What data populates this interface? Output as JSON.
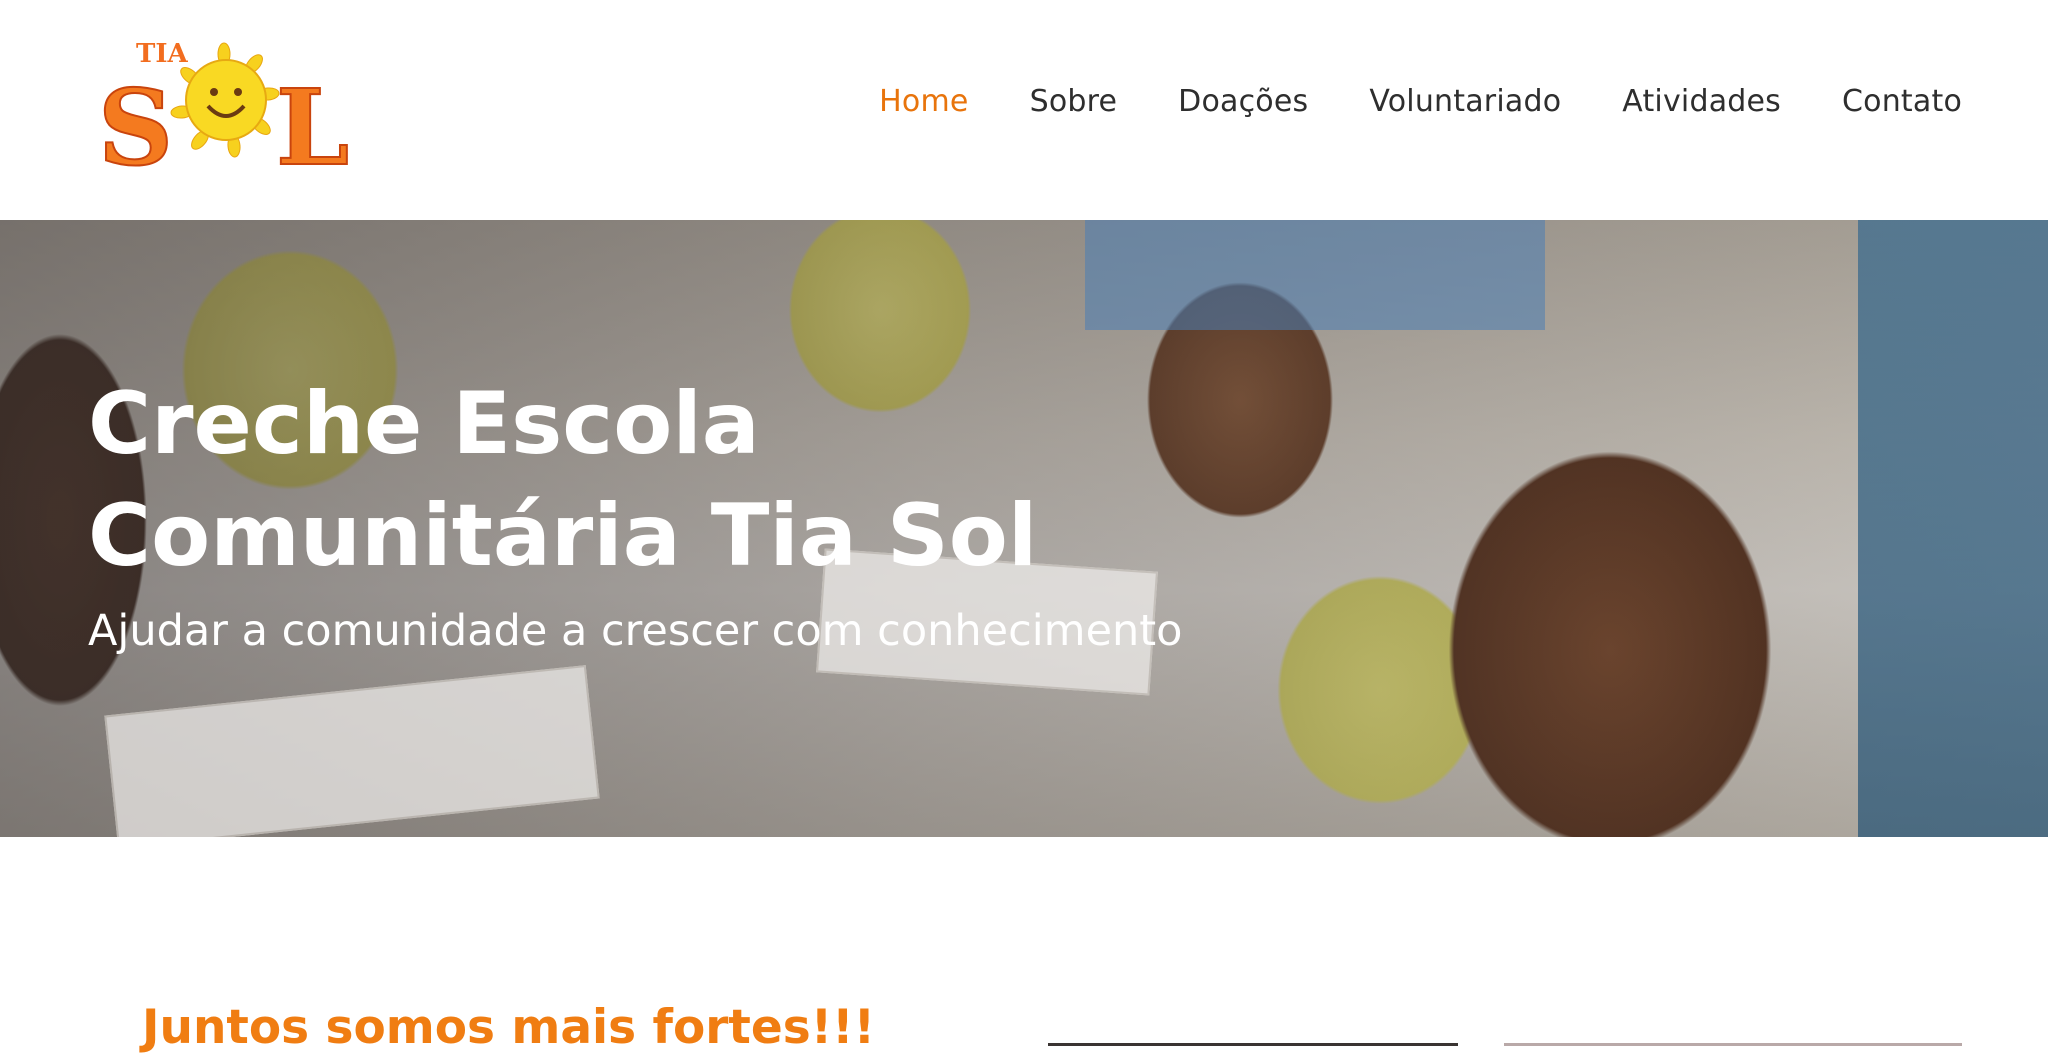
{
  "brand": {
    "logo_top": "TIA",
    "logo_main": "SOL"
  },
  "nav": {
    "items": [
      {
        "label": "Home",
        "active": true
      },
      {
        "label": "Sobre",
        "active": false
      },
      {
        "label": "Doações",
        "active": false
      },
      {
        "label": "Voluntariado",
        "active": false
      },
      {
        "label": "Atividades",
        "active": false
      },
      {
        "label": "Contato",
        "active": false
      }
    ]
  },
  "hero": {
    "title": "Creche Escola Comunitária Tia Sol",
    "subtitle": "Ajudar a comunidade a crescer com conhecimento"
  },
  "section": {
    "tagline": "Juntos somos mais fortes!!!"
  },
  "colors": {
    "accent": "#e8740c",
    "tagline": "#f07d12",
    "nav_text": "#2e2e2e"
  }
}
